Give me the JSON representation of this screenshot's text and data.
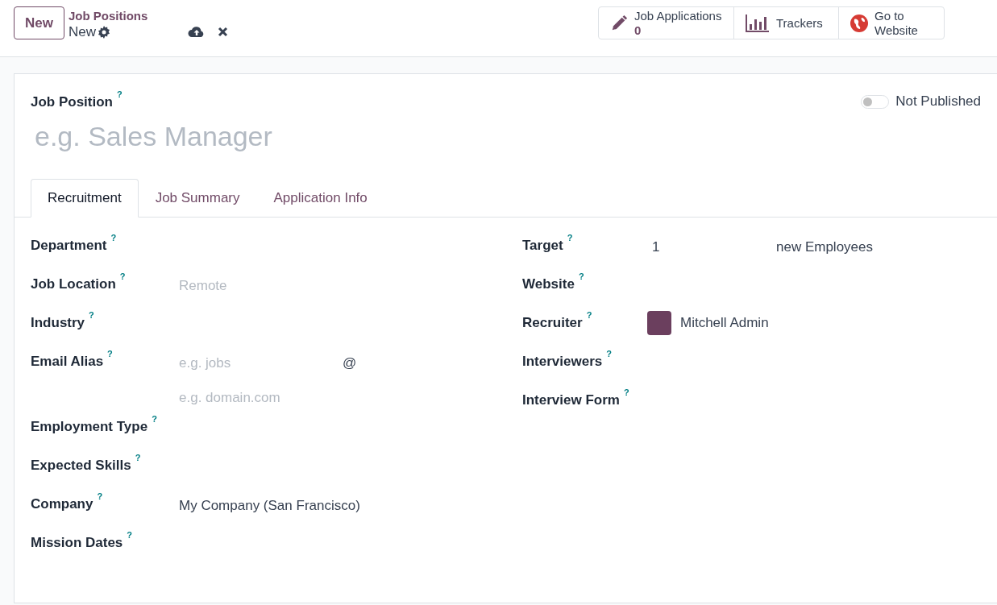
{
  "control_panel": {
    "new_button": "New",
    "breadcrumb": "Job Positions",
    "record": "New"
  },
  "smart_buttons": [
    {
      "kind": "applications",
      "label": "Job Applications",
      "value": "0"
    },
    {
      "kind": "trackers",
      "label": "Trackers"
    },
    {
      "kind": "website",
      "label": "Go to Website"
    }
  ],
  "publish": {
    "label": "Not Published",
    "on": false
  },
  "title": {
    "label": "Job Position",
    "help": "?",
    "placeholder": "e.g. Sales Manager"
  },
  "tabs": [
    {
      "label": "Recruitment",
      "selected": true
    },
    {
      "label": "Job Summary",
      "selected": false
    },
    {
      "label": "Application Info",
      "selected": false
    }
  ],
  "left_fields": [
    {
      "kind": "empty",
      "label": "Department",
      "help": "?"
    },
    {
      "kind": "placeholder",
      "label": "Job Location",
      "help": "?",
      "placeholder": "Remote"
    },
    {
      "kind": "empty",
      "label": "Industry",
      "help": "?"
    },
    {
      "kind": "alias",
      "label": "Email Alias",
      "help": "?",
      "placeholder": "e.g. jobs",
      "at": "@",
      "domain_placeholder": "e.g. domain.com"
    },
    {
      "kind": "empty",
      "label": "Employment Type",
      "help": "?"
    },
    {
      "kind": "empty",
      "label": "Expected Skills",
      "help": "?"
    },
    {
      "kind": "value",
      "label": "Company",
      "help": "?",
      "value": "My Company (San Francisco)"
    },
    {
      "kind": "empty",
      "label": "Mission Dates",
      "help": "?"
    }
  ],
  "right_fields": [
    {
      "kind": "target",
      "label": "Target",
      "help": "?",
      "value": "1",
      "unit": "new Employees"
    },
    {
      "kind": "empty",
      "label": "Website",
      "help": "?"
    },
    {
      "kind": "user",
      "label": "Recruiter",
      "help": "?",
      "value": "Mitchell Admin"
    },
    {
      "kind": "empty",
      "label": "Interviewers",
      "help": "?"
    },
    {
      "kind": "empty",
      "label": "Interview Form",
      "help": "?"
    }
  ]
}
